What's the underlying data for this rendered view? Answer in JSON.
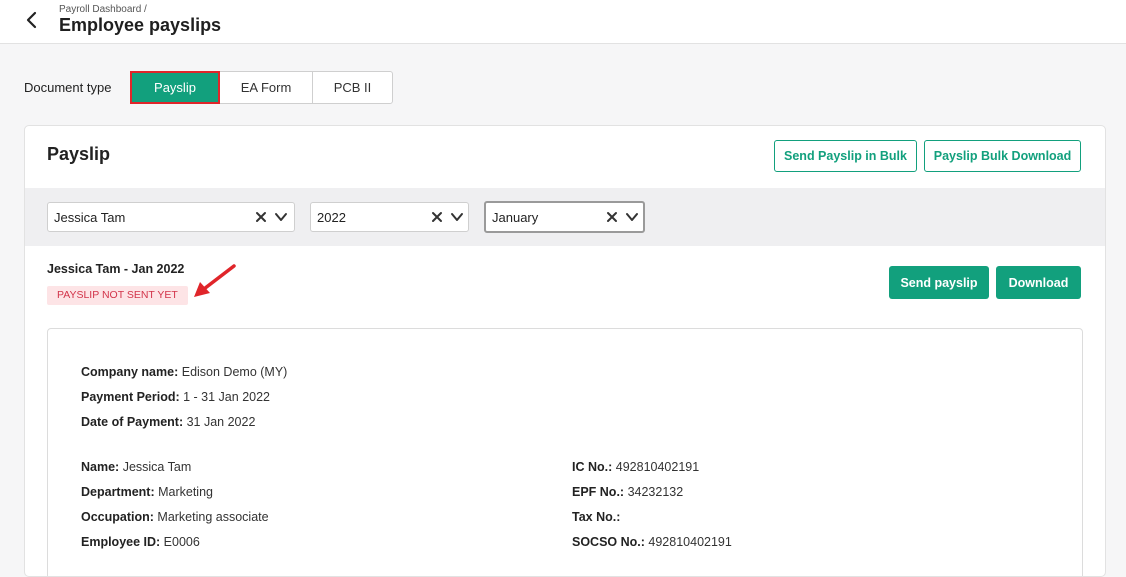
{
  "header": {
    "breadcrumb": "Payroll Dashboard /",
    "title": "Employee payslips"
  },
  "document_type": {
    "label": "Document type",
    "tabs": [
      {
        "label": "Payslip",
        "selected": true
      },
      {
        "label": "EA Form",
        "selected": false
      },
      {
        "label": "PCB II",
        "selected": false
      }
    ]
  },
  "card": {
    "title": "Payslip",
    "send_bulk_label": "Send Payslip in Bulk",
    "bulk_download_label": "Payslip Bulk Download"
  },
  "filters": {
    "employee": "Jessica Tam",
    "year": "2022",
    "month": "January"
  },
  "payslip": {
    "heading": "Jessica Tam - Jan 2022",
    "status": "PAYSLIP NOT SENT YET",
    "send_label": "Send payslip",
    "download_label": "Download"
  },
  "details": {
    "company_label": "Company name:",
    "company_value": "Edison Demo (MY)",
    "period_label": "Payment Period:",
    "period_value": "1 - 31 Jan 2022",
    "date_label": "Date of Payment:",
    "date_value": "31 Jan 2022",
    "name_label": "Name:",
    "name_value": "Jessica Tam",
    "department_label": "Department:",
    "department_value": "Marketing",
    "occupation_label": "Occupation:",
    "occupation_value": "Marketing associate",
    "employee_id_label": "Employee ID:",
    "employee_id_value": "E0006",
    "ic_label": "IC No.:",
    "ic_value": "492810402191",
    "epf_label": "EPF No.:",
    "epf_value": "34232132",
    "tax_label": "Tax No.:",
    "tax_value": "",
    "socso_label": "SOCSO No.:",
    "socso_value": "492810402191"
  },
  "colors": {
    "accent": "#12a07d",
    "highlight": "#e0252a",
    "badge_bg": "#fde4e6",
    "badge_text": "#d2344a"
  }
}
